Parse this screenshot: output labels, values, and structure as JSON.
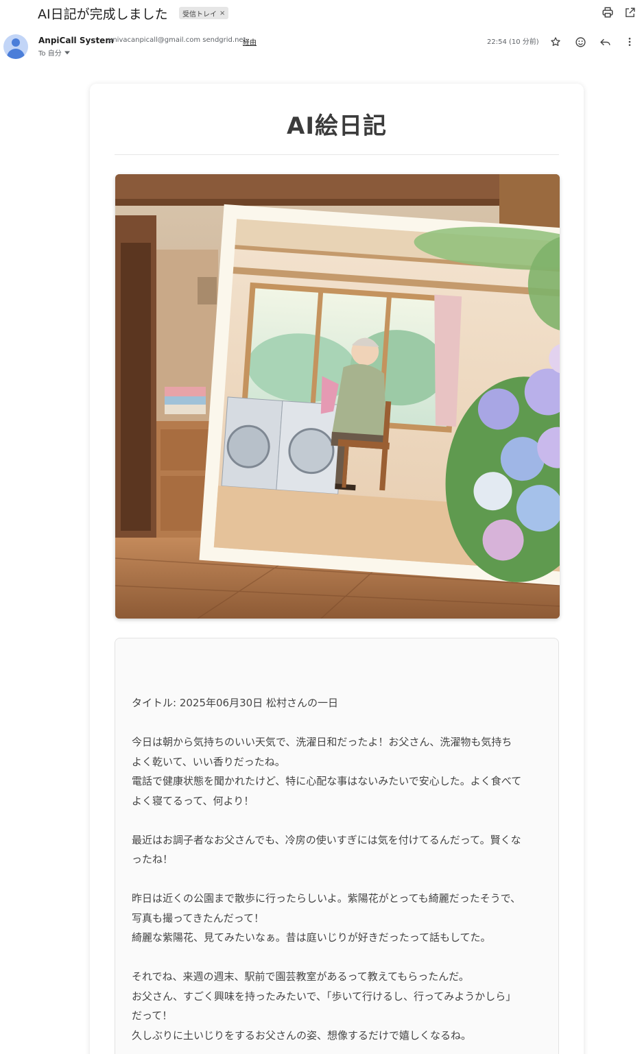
{
  "email": {
    "subject": "AI日記が完成しました",
    "label_chip": "受信トレイ",
    "label_remove": "×",
    "sender_name": "AnpiCall System",
    "sender_email": "univacanpicall@gmail.com sendgrid.net",
    "via_label": "経由",
    "to_label": "To 自分",
    "timestamp": "22:54 (10 分前)",
    "icons": [
      "print-icon",
      "open-in-new-window-icon",
      "star-icon",
      "emoji-icon",
      "reply-icon",
      "more-vert-icon",
      "chevron-down-icon"
    ]
  },
  "diary": {
    "heading": "AI絵日記",
    "image_caption": "",
    "title_line": "タイトル: 2025年06月30日 松村さんの一日",
    "body": "今日は朝から気持ちのいい天気で、洗濯日和だったよ！お父さん、洗濯物も気持ち\nよく乾いて、いい香りだったね。\n電話で健康状態を聞かれたけど、特に心配な事はないみたいで安心した。よく食べて\nよく寝てるって、何より！\n\n最近はお調子者なお父さんでも、冷房の使いすぎには気を付けてるんだって。賢くな\nったね！\n\n昨日は近くの公園まで散歩に行ったらしいよ。紫陽花がとっても綺麗だったそうで、\n写真も撮ってきたんだって！\n綺麗な紫陽花、見てみたいなぁ。昔は庭いじりが好きだったって話もしてた。\n\nそれでね、来週の週末、駅前で園芸教室があるって教えてもらったんだ。\nお父さん、すごく興味を持ったみたいで、「歩いて行けるし、行ってみようかしら」\nだって！\n久しぶりに土いじりをするお父さんの姿、想像するだけで嬉しくなるね。"
  },
  "colors": {
    "accent_blue": "#4b7ed9",
    "avatar_bg": "#c2d5f7",
    "title_text": "#3b3b3b",
    "body_text": "#444444"
  }
}
